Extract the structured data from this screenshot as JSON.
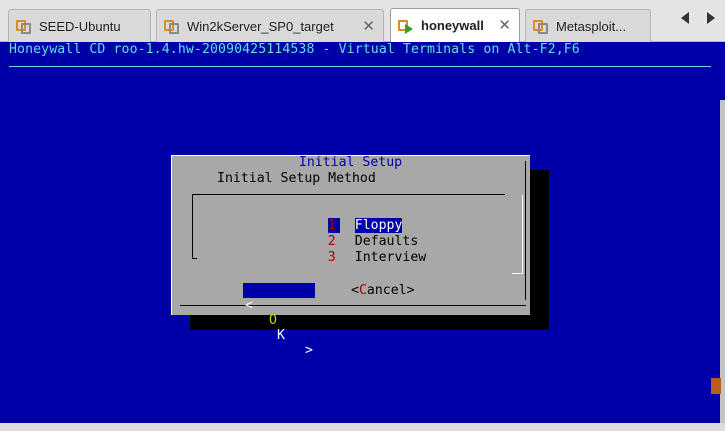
{
  "tabs": [
    {
      "label": "SEED-Ubuntu",
      "icon": "vm-icon",
      "active": false
    },
    {
      "label": "Win2kServer_SP0_target",
      "icon": "vm-icon",
      "active": false
    },
    {
      "label": "honeywall",
      "icon": "vm-running-icon",
      "active": true
    },
    {
      "label": "Metasploit...",
      "icon": "vm-icon",
      "active": false
    }
  ],
  "tab_close_glyph": "✕",
  "console": {
    "header": "Honeywall CD roo-1.4.hw-20090425114538 - Virtual Terminals on Alt-F2,F6"
  },
  "dialog": {
    "title": "Initial Setup",
    "subtitle": "Initial Setup Method",
    "menu": [
      {
        "tag": "1",
        "label": "Floppy",
        "selected": true
      },
      {
        "tag": "2",
        "label": "Defaults",
        "selected": false
      },
      {
        "tag": "3",
        "label": "Interview",
        "selected": false
      }
    ],
    "ok_button": {
      "open": "<",
      "hotkey": "O",
      "rest": "K",
      "close": ">"
    },
    "cancel_button": {
      "open": "<",
      "hotkey": "C",
      "rest": "ancel",
      "close": ">"
    }
  },
  "colors": {
    "console_bg": "#0000a8",
    "dialog_bg": "#a8a8a8",
    "title_fg": "#0000a8",
    "tag_fg": "#a80000",
    "highlight_bg": "#0000a8",
    "header_fg": "#5fe0e0"
  }
}
